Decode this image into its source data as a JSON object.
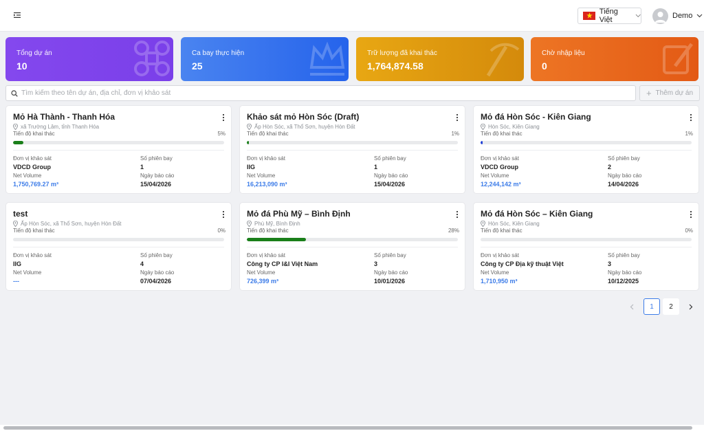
{
  "header": {
    "language": "Tiếng Việt",
    "user_name": "Demo"
  },
  "stats": [
    {
      "label": "Tổng dự án",
      "value": "10"
    },
    {
      "label": "Ca bay thực hiện",
      "value": "25"
    },
    {
      "label": "Trữ lượng đã khai thác",
      "value": "1,764,874.58"
    },
    {
      "label": "Chờ nhập liệu",
      "value": "0"
    }
  ],
  "search": {
    "placeholder": "Tìm kiếm theo tên dự án, địa chỉ, đơn vị khảo sát"
  },
  "add_button": "Thêm dự án",
  "field_labels": {
    "progress": "Tiến độ khai thác",
    "unit": "Đơn vị khảo sát",
    "flights": "Số phiên bay",
    "net_volume": "Net Volume",
    "report_date": "Ngày báo cáo"
  },
  "projects": [
    {
      "title": "Mỏ Hà Thành - Thanh Hóa",
      "location": "xã Trường Lâm, tỉnh Thanh Hóa",
      "progress_pct": "5%",
      "progress": 5,
      "unit": "VDCD Group",
      "flights": "1",
      "net_volume": "1,750,769.27 m³",
      "report_date": "15/04/2026"
    },
    {
      "title": "Khảo sát mỏ Hòn Sóc (Draft)",
      "location": "Ấp Hòn Sóc, xã Thổ Sơn, huyện Hòn Đất",
      "progress_pct": "1%",
      "progress": 1,
      "unit": "IIG",
      "flights": "1",
      "net_volume": "16,213,090 m³",
      "report_date": "15/04/2026"
    },
    {
      "title": "Mỏ đá Hòn Sóc - Kiên Giang",
      "location": "Hòn Sóc, Kiên Giang",
      "progress_pct": "1%",
      "progress": 1,
      "unit": "VDCD Group",
      "flights": "2",
      "net_volume": "12,244,142 m³",
      "report_date": "14/04/2026"
    },
    {
      "title": "test",
      "location": "Ấp Hòn Sóc, xã Thổ Sơn, huyện Hòn Đất",
      "progress_pct": "0%",
      "progress": 0,
      "unit": "IIG",
      "flights": "4",
      "net_volume": "---",
      "report_date": "07/04/2026"
    },
    {
      "title": "Mỏ đá Phù Mỹ – Bình Định",
      "location": "Phù Mỹ, Bình Định",
      "progress_pct": "28%",
      "progress": 28,
      "unit": "Công ty CP I&I Việt Nam",
      "flights": "3",
      "net_volume": "726,399 m³",
      "report_date": "10/01/2026"
    },
    {
      "title": "Mỏ đá Hòn Sóc – Kiên Giang",
      "location": "Hòn Sóc, Kiên Giang",
      "progress_pct": "0%",
      "progress": 0,
      "unit": "Công ty CP Địa kỹ thuật Việt",
      "flights": "3",
      "net_volume": "1,710,950 m³",
      "report_date": "10/12/2025"
    }
  ],
  "pagination": {
    "pages": [
      "1",
      "2"
    ],
    "current": "1"
  },
  "colors": {
    "progress_green": "#1a7f1a",
    "progress_blue": "#1f3fd6",
    "volume_blue": "#3b7be8",
    "accent": "#3b7be8"
  }
}
